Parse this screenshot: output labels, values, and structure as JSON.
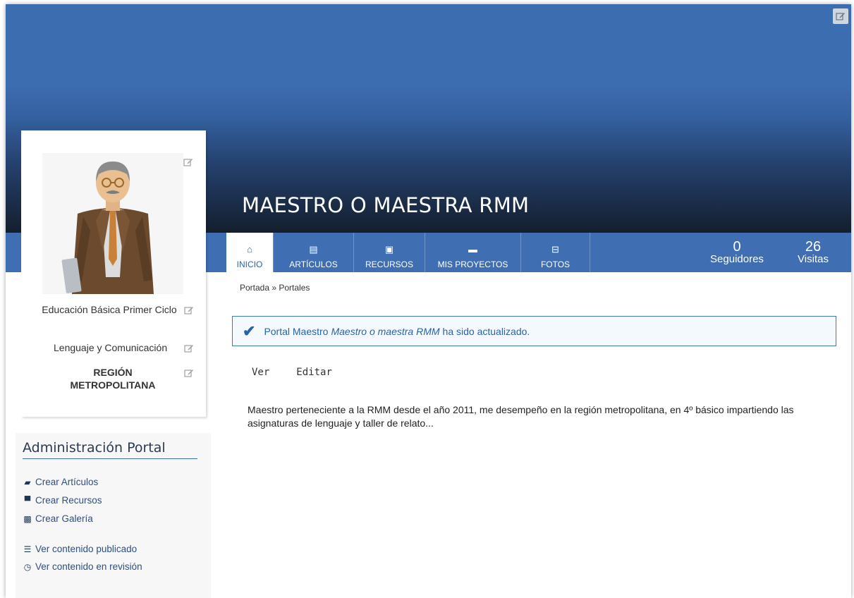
{
  "portal": {
    "title": "MAESTRO O MAESTRA RMM"
  },
  "nav": {
    "tabs": [
      {
        "label": "INICIO",
        "icon": "home-icon"
      },
      {
        "label": "ARTÍCULOS",
        "icon": "article-icon"
      },
      {
        "label": "RECURSOS",
        "icon": "archive-icon"
      },
      {
        "label": "MIS PROYECTOS",
        "icon": "folder-icon"
      },
      {
        "label": "FOTOS",
        "icon": "photos-icon"
      }
    ],
    "active_tab": "INICIO",
    "stats": {
      "followers_count": "0",
      "followers_label": "Seguidores",
      "visits_count": "26",
      "visits_label": "Visitas"
    }
  },
  "profile": {
    "level": "Educación Básica Primer Ciclo",
    "subject": "Lenguaje y Comunicación",
    "region": "REGIÓN METROPOLITANA"
  },
  "admin": {
    "title": "Administración Portal",
    "links": [
      {
        "label": "Crear Artículos",
        "icon": "book-icon"
      },
      {
        "label": "Crear Recursos",
        "icon": "archive-icon"
      },
      {
        "label": "Crear Galería",
        "icon": "image-icon"
      },
      {
        "label": "Ver contenido publicado",
        "icon": "list-icon"
      },
      {
        "label": "Ver contenido en revisión",
        "icon": "clock-icon"
      }
    ]
  },
  "breadcrumb": "Portada » Portales",
  "alert": {
    "prefix": "Portal Maestro",
    "name": "Maestro o maestra RMM",
    "suffix": "ha sido actualizado."
  },
  "view_tabs": [
    "Ver",
    "Editar"
  ],
  "description": "Maestro perteneciente a la RMM desde el año 2011, me desempeño en la región metropolitana, en 4º básico impartiendo las asignaturas de lenguaje y taller de relato...",
  "colors": {
    "accent": "#3f6eb3",
    "banner_top": "#3d6db1",
    "banner_bottom": "#141e2e",
    "link": "#2b4f86"
  }
}
